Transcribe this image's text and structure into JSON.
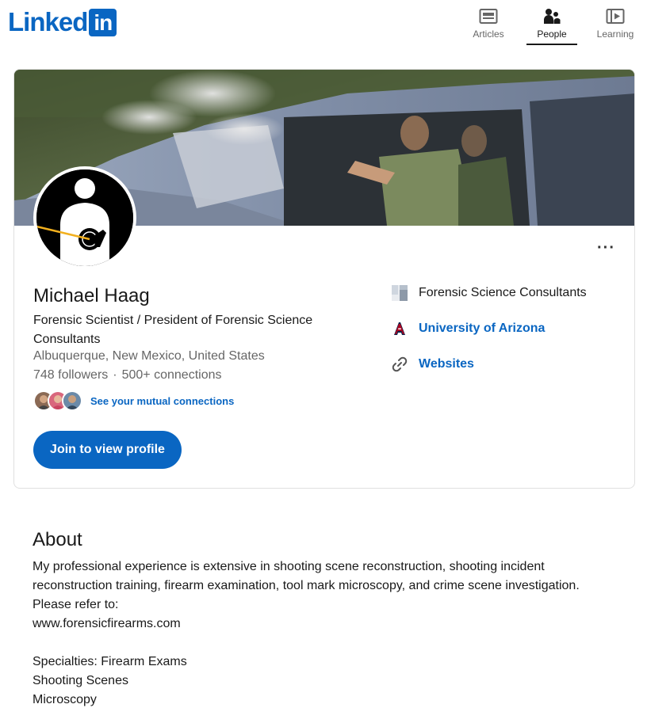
{
  "header": {
    "logo_text": "Linked",
    "logo_box": "in",
    "nav": [
      {
        "label": "Articles",
        "icon": "articles-icon",
        "active": false
      },
      {
        "label": "People",
        "icon": "people-icon",
        "active": true
      },
      {
        "label": "Learning",
        "icon": "learning-icon",
        "active": false
      }
    ]
  },
  "profile": {
    "name": "Michael Haag",
    "headline": "Forensic Scientist / President of Forensic Science Consultants",
    "location": "Albuquerque, New Mexico, United States",
    "followers": "748 followers",
    "connections": "500+ connections",
    "stats_separator": "·",
    "mutual_link": "See your mutual connections",
    "join_button": "Join to view profile",
    "more_button": "···",
    "side": [
      {
        "label": "Forensic Science Consultants",
        "icon": "company-logo-icon"
      },
      {
        "label": "University of Arizona",
        "icon": "university-logo-icon"
      },
      {
        "label": "Websites",
        "icon": "link-icon"
      }
    ]
  },
  "about": {
    "title": "About",
    "body": "My professional experience is extensive in shooting scene reconstruction, shooting incident reconstruction training, firearm examination, tool mark microscopy, and crime scene investigation.\nPlease refer to:\nwww.forensicfirearms.com\n\nSpecialties: Firearm Exams\nShooting Scenes\nMicroscopy"
  },
  "colors": {
    "brand": "#0a66c2",
    "text": "#191919",
    "muted": "#666666"
  }
}
